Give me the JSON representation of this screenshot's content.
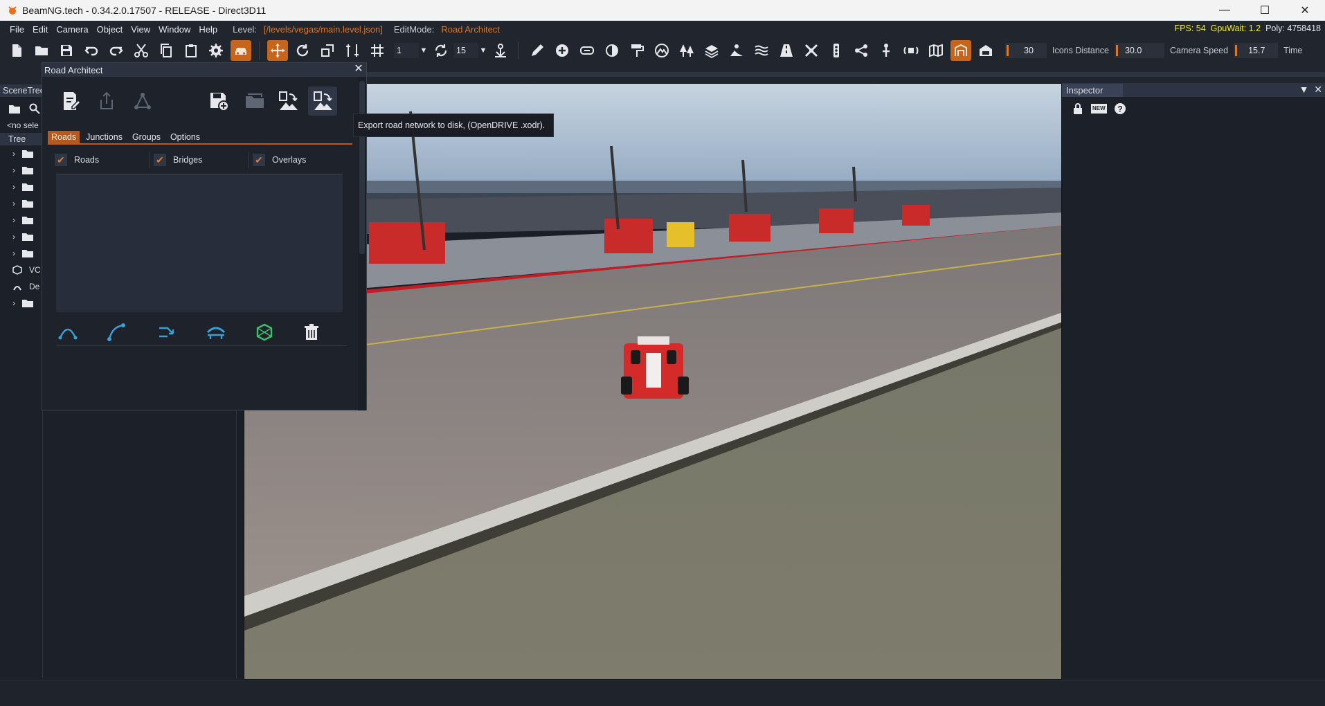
{
  "window": {
    "title": "BeamNG.tech - 0.34.2.0.17507 - RELEASE - Direct3D11",
    "minimize": "—",
    "maximize": "☐",
    "close": "✕"
  },
  "menubar": {
    "items": [
      "File",
      "Edit",
      "Camera",
      "Object",
      "View",
      "Window",
      "Help"
    ],
    "level_label": "Level:",
    "level_path": "[/levels/vegas/main.level.json]",
    "editmode_label": "EditMode:",
    "editmode_value": "Road Architect",
    "fps": "FPS: 54",
    "gpuwait": "GpuWait: 1.2",
    "poly": "Poly: 4758418"
  },
  "toolbar": {
    "snap_value": "1",
    "rotate_value": "15",
    "icons_distance_value": "30",
    "icons_distance_label": "Icons Distance",
    "camera_speed_value": "30.0",
    "camera_speed_label": "Camera Speed",
    "time_value": "15.7",
    "time_label": "Time",
    "accent": "#c8651c"
  },
  "scenetree": {
    "header": "SceneTree",
    "no_selection": "<no sele",
    "tree_label": "Tree",
    "rows": [
      "",
      "",
      "",
      "",
      "",
      "",
      "",
      "VC",
      "De",
      ""
    ]
  },
  "inspector": {
    "header": "Inspector",
    "new_icon_label": "NEW"
  },
  "road_architect": {
    "title": "Road Architect",
    "tabs": [
      "Roads",
      "Junctions",
      "Groups",
      "Options"
    ],
    "active_tab": "Roads",
    "checkboxes": [
      {
        "label": "Roads",
        "checked": true
      },
      {
        "label": "Bridges",
        "checked": true
      },
      {
        "label": "Overlays",
        "checked": true
      }
    ],
    "check_mark": "✔"
  },
  "tooltip": {
    "text": "Export road network to disk, (OpenDRIVE .xodr)."
  },
  "colors": {
    "orange": "#d9772a",
    "stats_yellow": "#f0ec2a",
    "teal_icon": "#3a9fd2",
    "green_icon": "#3fbf6a"
  }
}
